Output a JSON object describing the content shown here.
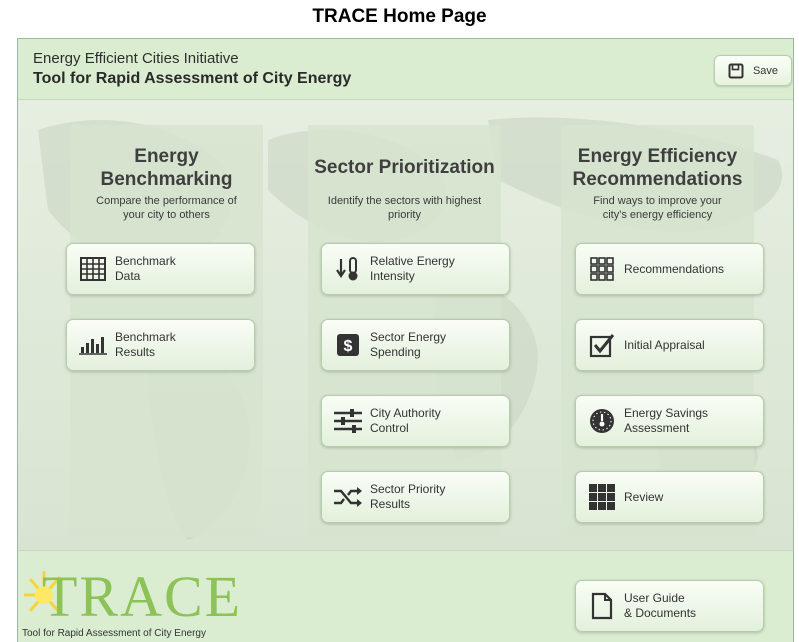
{
  "caption": "TRACE Home Page",
  "header": {
    "line1": "Energy Efficient Cities Initiative",
    "line2": "Tool for Rapid Assessment of City Energy",
    "save_label": "Save"
  },
  "columns": [
    {
      "title": "Energy\nBenchmarking",
      "description": "Compare the performance of\nyour city to others",
      "buttons": [
        {
          "label": "Benchmark\nData",
          "icon": "grid-table-icon"
        },
        {
          "label": "Benchmark\nResults",
          "icon": "bar-chart-icon"
        }
      ]
    },
    {
      "title": "Sector Prioritization",
      "description": "Identify the sectors with highest\npriority",
      "buttons": [
        {
          "label": "Relative Energy\nIntensity",
          "icon": "thermometer-arrows-icon"
        },
        {
          "label": "Sector Energy\nSpending",
          "icon": "dollar-icon"
        },
        {
          "label": "City Authority\nControl",
          "icon": "sliders-icon"
        },
        {
          "label": "Sector Priority\nResults",
          "icon": "shuffle-icon"
        }
      ]
    },
    {
      "title": "Energy Efficiency\nRecommendations",
      "description": "Find ways to improve your\ncity's energy efficiency",
      "buttons": [
        {
          "label": "Recommendations",
          "icon": "grid-outline-icon"
        },
        {
          "label": "Initial Appraisal",
          "icon": "checkbox-icon"
        },
        {
          "label": "Energy Savings\nAssessment",
          "icon": "gauge-icon"
        },
        {
          "label": "Review",
          "icon": "grid-solid-icon"
        }
      ]
    }
  ],
  "footer": {
    "logo_word": "TRACE",
    "logo_tagline": "Tool for Rapid Assessment of City Energy",
    "user_guide_label": "User Guide\n& Documents"
  }
}
